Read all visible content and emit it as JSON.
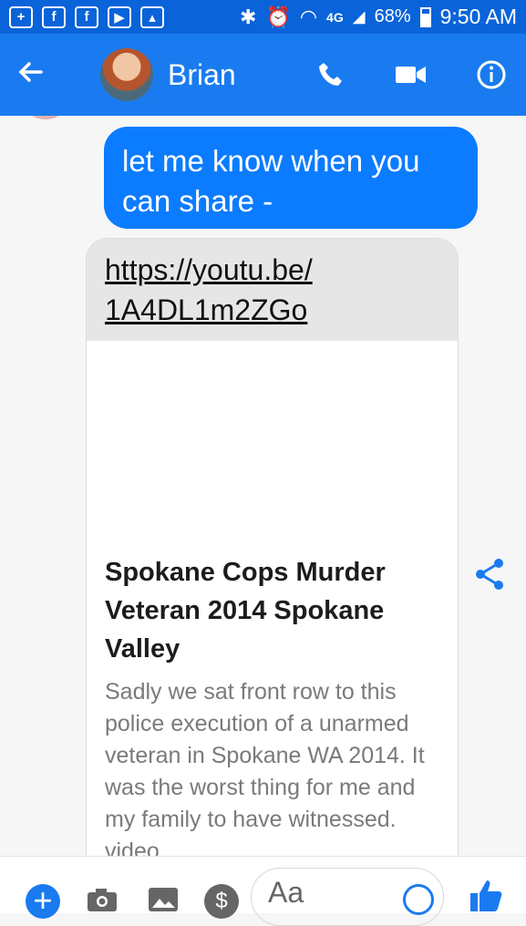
{
  "status_bar": {
    "network": "4G",
    "battery": "68%",
    "battery_level": 0.68,
    "time": "9:50 AM",
    "icons": [
      "plus-box-icon",
      "facebook-icon",
      "facebook-icon",
      "youtube-icon",
      "gallery-icon",
      "bluetooth-icon",
      "alarm-icon",
      "wifi-icon",
      "signal-icon"
    ]
  },
  "header": {
    "contact_name": "Brian",
    "back_icon": "arrow-left-icon",
    "actions": [
      "phone-icon",
      "video-icon",
      "info-icon"
    ]
  },
  "messages": {
    "outgoing_text": "let me know when you can share -",
    "link_url_line1": "https://youtu.be/",
    "link_url_line2": "1A4DL1m2ZGo",
    "link_title": "Spokane Cops Murder Veteran 2014 Spokane Valley",
    "link_description": "Sadly we sat front row to this police execution of a unarmed veteran in Spokane WA 2014. It was the worst thing for me and my family to have witnessed. video"
  },
  "composer": {
    "placeholder": "Aa",
    "dollar_symbol": "$",
    "plus_symbol": "+",
    "icons": [
      "plus-icon",
      "camera-icon",
      "image-icon",
      "dollar-icon",
      "emoji-icon",
      "like-icon"
    ]
  },
  "colors": {
    "status_bar": "#0a63d8",
    "header": "#1a7bf0",
    "outgoing_bubble": "#0b7cff",
    "accent": "#1a7bf0"
  }
}
